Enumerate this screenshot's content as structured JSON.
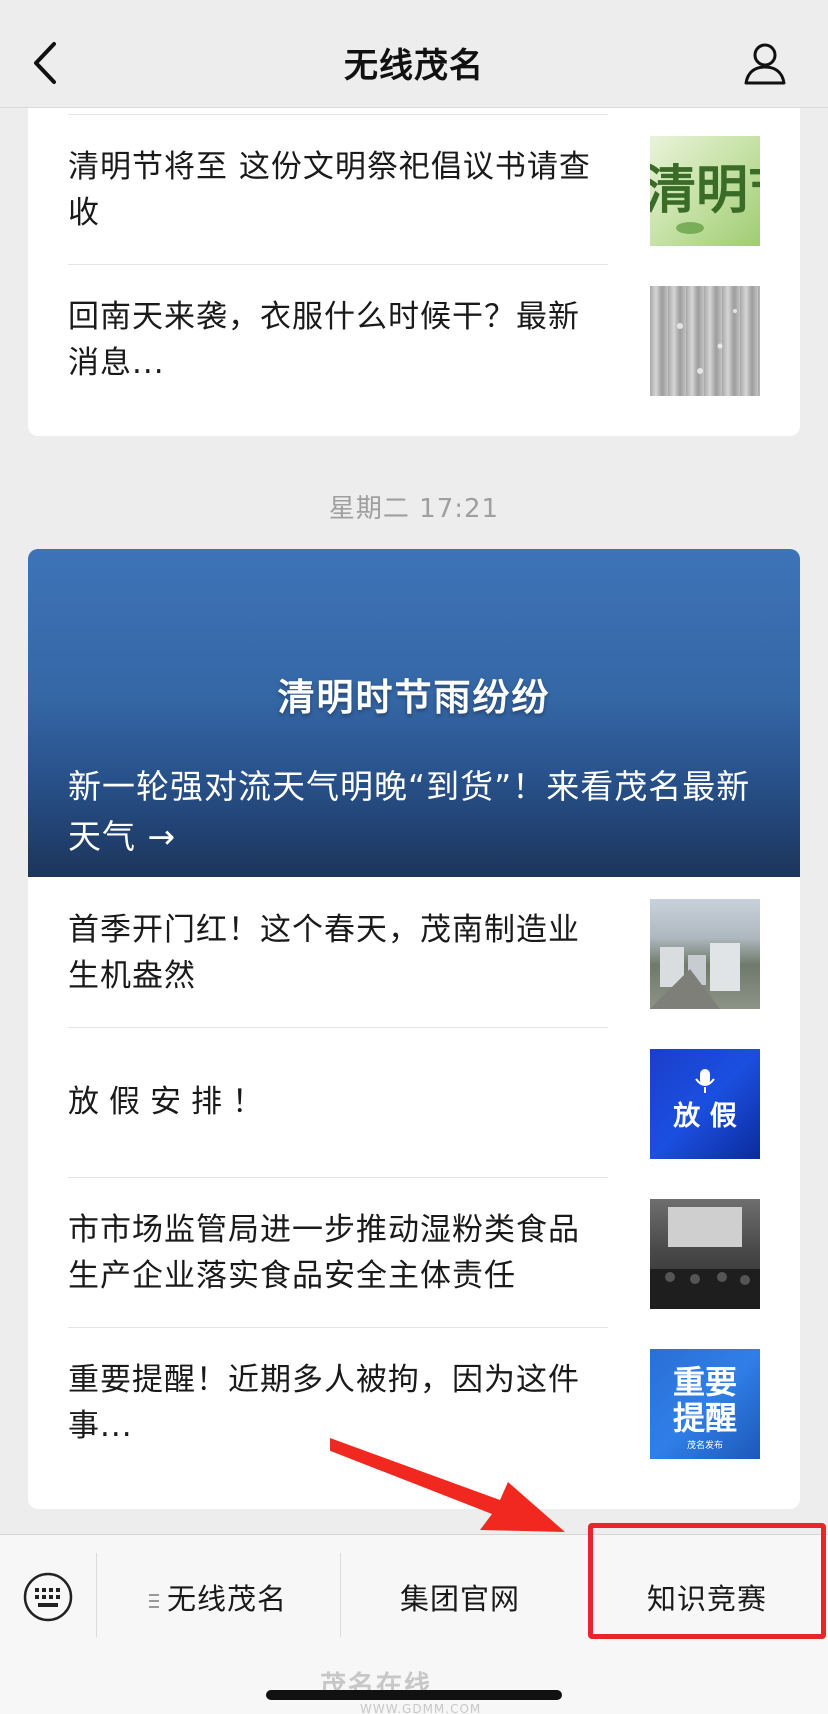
{
  "header": {
    "title": "无线茂名"
  },
  "card1": {
    "items": [
      {
        "text": "清明节将至 这份文明祭祀倡议书请查收",
        "thumb_text": "清明节"
      },
      {
        "text": "回南天来袭，衣服什么时候干？最新消息..."
      }
    ]
  },
  "timestamp": "星期二 17:21",
  "card2": {
    "banner": {
      "overlay_title": "清明时节雨纷纷",
      "headline": "新一轮强对流天气明晚“到货”！来看茂名最新天气 →"
    },
    "items": [
      {
        "text": "首季开门红！这个春天，茂南制造业生机盎然"
      },
      {
        "text": "放假安排！",
        "thumb_text": "放 假"
      },
      {
        "text": "市市场监管局进一步推动湿粉类食品生产企业落实食品安全主体责任"
      },
      {
        "text": "重要提醒！近期多人被拘，因为这件事...",
        "thumb_text_1": "重要",
        "thumb_text_2": "提醒",
        "thumb_caption": "茂名发布"
      }
    ]
  },
  "menu": {
    "items": [
      "无线茂名",
      "集团官网",
      "知识竞赛"
    ]
  },
  "watermark": {
    "text": "茂名在线",
    "url": "WWW.GDMM.COM"
  },
  "colors": {
    "highlight": "#e5262a",
    "banner_top": "#3d73b8",
    "banner_bottom": "#1c355c"
  }
}
